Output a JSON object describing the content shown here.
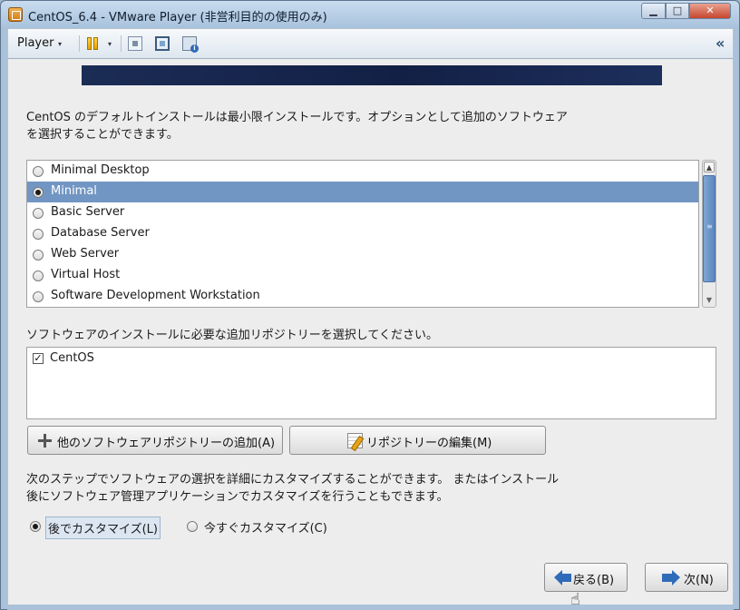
{
  "window": {
    "title": "CentOS_6.4 - VMware Player (非営利目的の使用のみ)",
    "controls": {
      "minimize": "▁",
      "maximize": "□",
      "close": "✕"
    }
  },
  "toolbar": {
    "player_label": "Player",
    "dropdown_glyph": "▾",
    "collapse_glyph": "«",
    "icons": [
      "pause-icon",
      "network-icon",
      "fullscreen-icon",
      "unity-icon"
    ]
  },
  "installer": {
    "intro_line1": "CentOS のデフォルトインストールは最小限インストールです。オプションとして追加のソフトウェア",
    "intro_line2": "を選択することができます。",
    "profiles": [
      {
        "label": "Minimal Desktop",
        "selected": false
      },
      {
        "label": "Minimal",
        "selected": true
      },
      {
        "label": "Basic Server",
        "selected": false
      },
      {
        "label": "Database Server",
        "selected": false
      },
      {
        "label": "Web Server",
        "selected": false
      },
      {
        "label": "Virtual Host",
        "selected": false
      },
      {
        "label": "Software Development Workstation",
        "selected": false
      }
    ],
    "repo_prompt": "ソフトウェアのインストールに必要な追加リポジトリーを選択してください。",
    "repos": [
      {
        "label": "CentOS",
        "checked": true,
        "check_glyph": "✓"
      }
    ],
    "add_repo_button": "他のソフトウェアリポジトリーの追加(A)",
    "edit_repo_button": "リポジトリーの編集(M)",
    "customize_line1": "次のステップでソフトウェアの選択を詳細にカスタマイズすることができます。 またはインストール",
    "customize_line2": "後にソフトウェア管理アプリケーションでカスタマイズを行うこともできます。",
    "customize_later": "後でカスタマイズ(L)",
    "customize_now": "今すぐカスタマイズ(C)",
    "customize_selected": "later",
    "back_button": "戻る(B)",
    "next_button": "次(N)"
  },
  "scrollbar": {
    "up_glyph": "▲",
    "down_glyph": "▼",
    "grip_glyph": "≡"
  },
  "colors": {
    "selection": "#7196c3",
    "banner": "#1b2c55",
    "titlebar": "#b8cfe6",
    "arrow": "#2f6bb8"
  }
}
